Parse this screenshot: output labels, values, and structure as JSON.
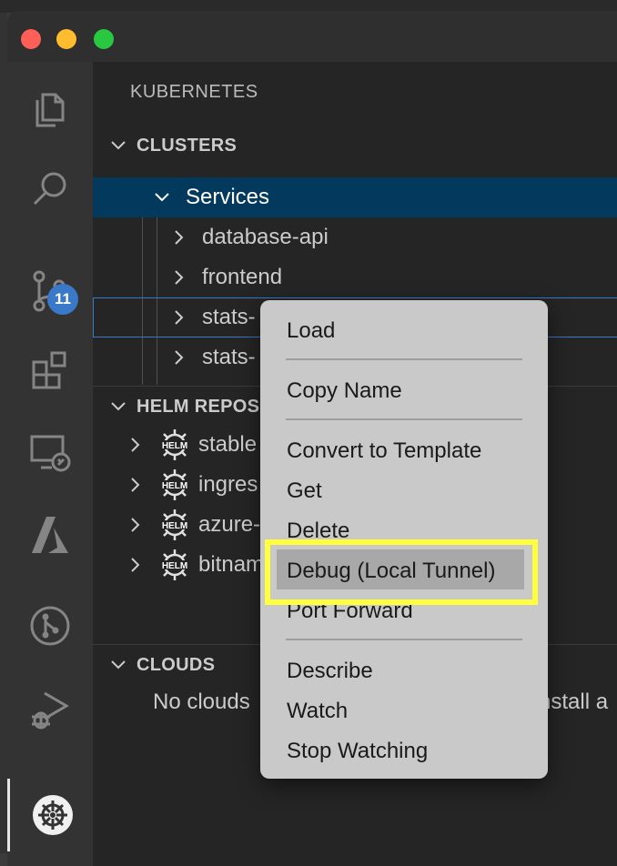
{
  "sidebar": {
    "title": "KUBERNETES",
    "clusters": {
      "header": "CLUSTERS",
      "services_label": "Services",
      "items": [
        {
          "label": "database-api"
        },
        {
          "label": "frontend"
        },
        {
          "label": "stats-"
        },
        {
          "label": "stats-"
        }
      ]
    },
    "helm": {
      "header": "HELM REPOS",
      "icon_text": "HELM",
      "items": [
        {
          "label": "stable"
        },
        {
          "label": "ingres"
        },
        {
          "label": "azure-"
        },
        {
          "label": "bitnam"
        }
      ]
    },
    "clouds": {
      "header": "CLOUDS",
      "message_left": "No clouds",
      "message_right": "nstall a"
    }
  },
  "activity_bar": {
    "source_control_badge": "11",
    "icons": [
      "files-icon",
      "search-icon",
      "source-control-icon",
      "extensions-icon",
      "remote-explorer-icon",
      "azure-icon",
      "git-graph-icon",
      "run-debug-icon",
      "kubernetes-icon"
    ]
  },
  "context_menu": {
    "items": [
      {
        "label": "Load"
      },
      {
        "label": "Copy Name"
      },
      {
        "label": "Convert to Template"
      },
      {
        "label": "Get"
      },
      {
        "label": "Delete"
      },
      {
        "label": "Debug (Local Tunnel)"
      },
      {
        "label": "Port Forward"
      },
      {
        "label": "Describe"
      },
      {
        "label": "Watch"
      },
      {
        "label": "Stop Watching"
      }
    ]
  },
  "colors": {
    "selection": "#04395e",
    "badge": "#3a78c9",
    "highlight": "#ffff3d"
  }
}
